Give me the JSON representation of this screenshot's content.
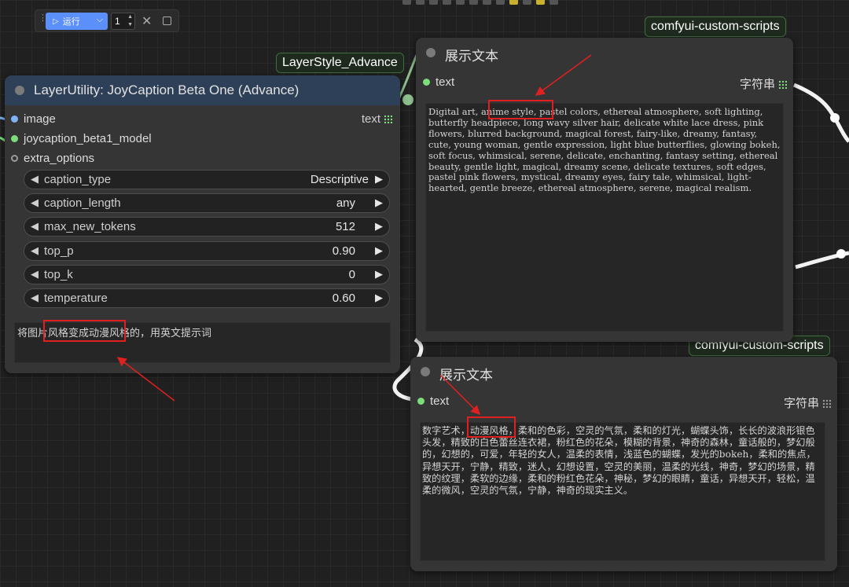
{
  "toolbar": {
    "run_label": "运行",
    "queue_count": "1"
  },
  "tags": {
    "layerstyle": "LayerStyle_Advance",
    "custom_scripts_1": "comfyui-custom-scripts",
    "custom_scripts_2": "comfyui-custom-scripts"
  },
  "joycaption_node": {
    "title": "LayerUtility: JoyCaption Beta One (Advance)",
    "inputs": [
      "image",
      "joycaption_beta1_model",
      "extra_options"
    ],
    "output": "text",
    "widgets": [
      {
        "name": "caption_type",
        "value": "Descriptive"
      },
      {
        "name": "caption_length",
        "value": "any"
      },
      {
        "name": "max_new_tokens",
        "value": "512"
      },
      {
        "name": "top_p",
        "value": "0.90"
      },
      {
        "name": "top_k",
        "value": "0"
      },
      {
        "name": "temperature",
        "value": "0.60"
      }
    ],
    "prompt": "将图片风格变成动漫风格的，用英文提示词"
  },
  "show_text_en": {
    "title": "展示文本",
    "input": "text",
    "output": "字符串",
    "text": "Digital art, anime style, pastel colors, ethereal atmosphere, soft lighting, butterfly headpiece, long wavy silver hair, delicate white lace dress, pink flowers, blurred background, magical forest, fairy-like, dreamy, fantasy, cute, young woman, gentle expression, light blue butterflies, glowing bokeh, soft focus, whimsical, serene, delicate, enchanting, fantasy setting, ethereal beauty, gentle light, magical, dreamy scene, delicate textures, soft edges, pastel pink flowers, mystical, dreamy eyes, fairy tale, whimsical, light-hearted, gentle breeze, ethereal atmosphere, serene, magical realism."
  },
  "show_text_zh": {
    "title": "展示文本",
    "input": "text",
    "output": "字符串",
    "text": "数字艺术，动漫风格，柔和的色彩，空灵的气氛，柔和的灯光，蝴蝶头饰，长长的波浪形银色头发，精致的白色蕾丝连衣裙，粉红色的花朵，模糊的背景，神奇的森林，童话般的，梦幻般的，幻想的，可爱，年轻的女人，温柔的表情，浅蓝色的蝴蝶，发光的bokeh，柔和的焦点，异想天开，宁静，精致，迷人，幻想设置，空灵的美丽，温柔的光线，神奇，梦幻的场景，精致的纹理，柔软的边缘，柔和的粉红色花朵，神秘，梦幻的眼睛，童话，异想天开，轻松，温柔的微风，空灵的气氛，宁静，神奇的现实主义。"
  },
  "colors": {
    "canvas": "#202020",
    "node_body": "#353535",
    "joycaption_title": "#2e3f58",
    "run_button": "#5b8ff9",
    "highlight": "#e02020",
    "pin_green": "#7bde7b"
  }
}
